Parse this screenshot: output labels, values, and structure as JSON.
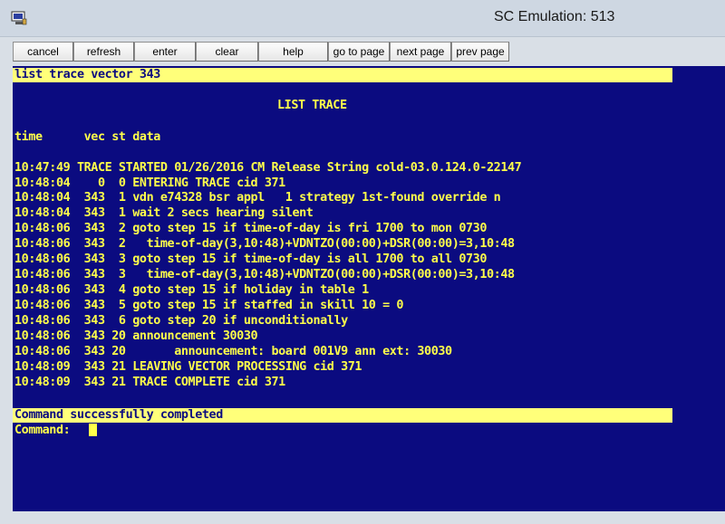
{
  "window": {
    "title": "SC Emulation: 513",
    "app_icon": "terminal-app-icon"
  },
  "toolbar": {
    "buttons": [
      {
        "label": "cancel"
      },
      {
        "label": "refresh"
      },
      {
        "label": "enter"
      },
      {
        "label": "clear"
      },
      {
        "label": "help"
      },
      {
        "label": "go to page"
      },
      {
        "label": "next page"
      },
      {
        "label": "prev page"
      }
    ]
  },
  "terminal": {
    "command_line": "list trace vector 343",
    "heading": "LIST TRACE",
    "column_headers": "time      vec st data",
    "lines": [
      "10:47:49 TRACE STARTED 01/26/2016 CM Release String cold-03.0.124.0-22147",
      "10:48:04    0  0 ENTERING TRACE cid 371",
      "10:48:04  343  1 vdn e74328 bsr appl   1 strategy 1st-found override n",
      "10:48:04  343  1 wait 2 secs hearing silent",
      "10:48:06  343  2 goto step 15 if time-of-day is fri 1700 to mon 0730",
      "10:48:06  343  2   time-of-day(3,10:48)+VDNTZO(00:00)+DSR(00:00)=3,10:48",
      "10:48:06  343  3 goto step 15 if time-of-day is all 1700 to all 0730",
      "10:48:06  343  3   time-of-day(3,10:48)+VDNTZO(00:00)+DSR(00:00)=3,10:48",
      "10:48:06  343  4 goto step 15 if holiday in table 1",
      "10:48:06  343  5 goto step 15 if staffed in skill 10 = 0",
      "10:48:06  343  6 goto step 20 if unconditionally",
      "10:48:06  343 20 announcement 30030",
      "10:48:06  343 20       announcement: board 001V9 ann ext: 30030",
      "10:48:09  343 21 LEAVING VECTOR PROCESSING cid 371",
      "10:48:09  343 21 TRACE COMPLETE cid 371"
    ],
    "status_message": "Command successfully completed",
    "prompt": "Command:"
  }
}
